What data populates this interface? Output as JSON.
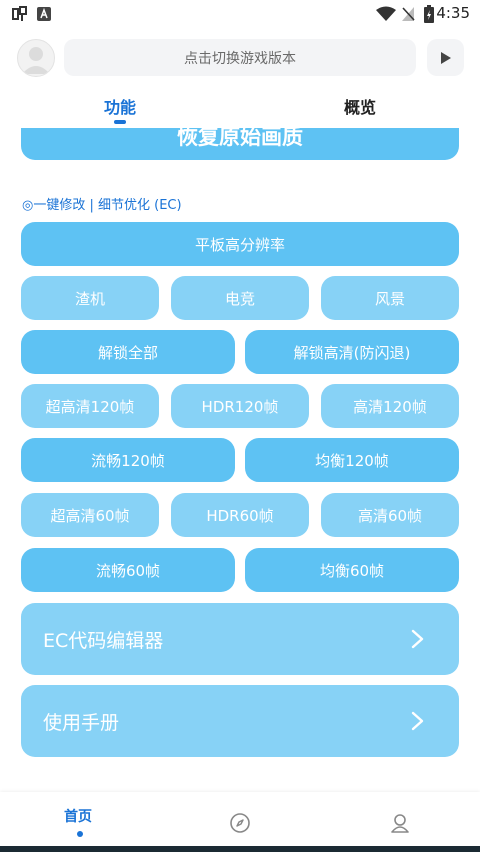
{
  "status_bar": {
    "time": "4:35",
    "icons": [
      "app-notification-icon",
      "a-notification-icon",
      "wifi-icon",
      "no-signal-icon",
      "battery-charging-icon"
    ]
  },
  "header": {
    "version_switch_label": "点击切换游戏版本"
  },
  "tabs": [
    {
      "label": "功能",
      "active": true
    },
    {
      "label": "概览",
      "active": false
    }
  ],
  "content": {
    "restore_button": "恢复原始画质",
    "section_label": "◎一键修改 | 细节优化 (EC)",
    "buttons": {
      "tablet_resolution": "平板高分辨率",
      "row2": [
        "渣机",
        "电竞",
        "风景"
      ],
      "row3": [
        "解锁全部",
        "解锁高清(防闪退)"
      ],
      "row4": [
        "超高清120帧",
        "HDR120帧",
        "高清120帧"
      ],
      "row5": [
        "流畅120帧",
        "均衡120帧"
      ],
      "row6": [
        "超高清60帧",
        "HDR60帧",
        "高清60帧"
      ],
      "row7": [
        "流畅60帧",
        "均衡60帧"
      ]
    },
    "cards": [
      {
        "label": "EC代码编辑器"
      },
      {
        "label": "使用手册"
      }
    ]
  },
  "bottom_nav": {
    "home_label": "首页",
    "items": [
      "home",
      "compass-icon",
      "profile-icon"
    ]
  },
  "colors": {
    "accent": "#1a73d6",
    "button_dark": "#5ec2f3",
    "button_light": "#87d2f6"
  }
}
